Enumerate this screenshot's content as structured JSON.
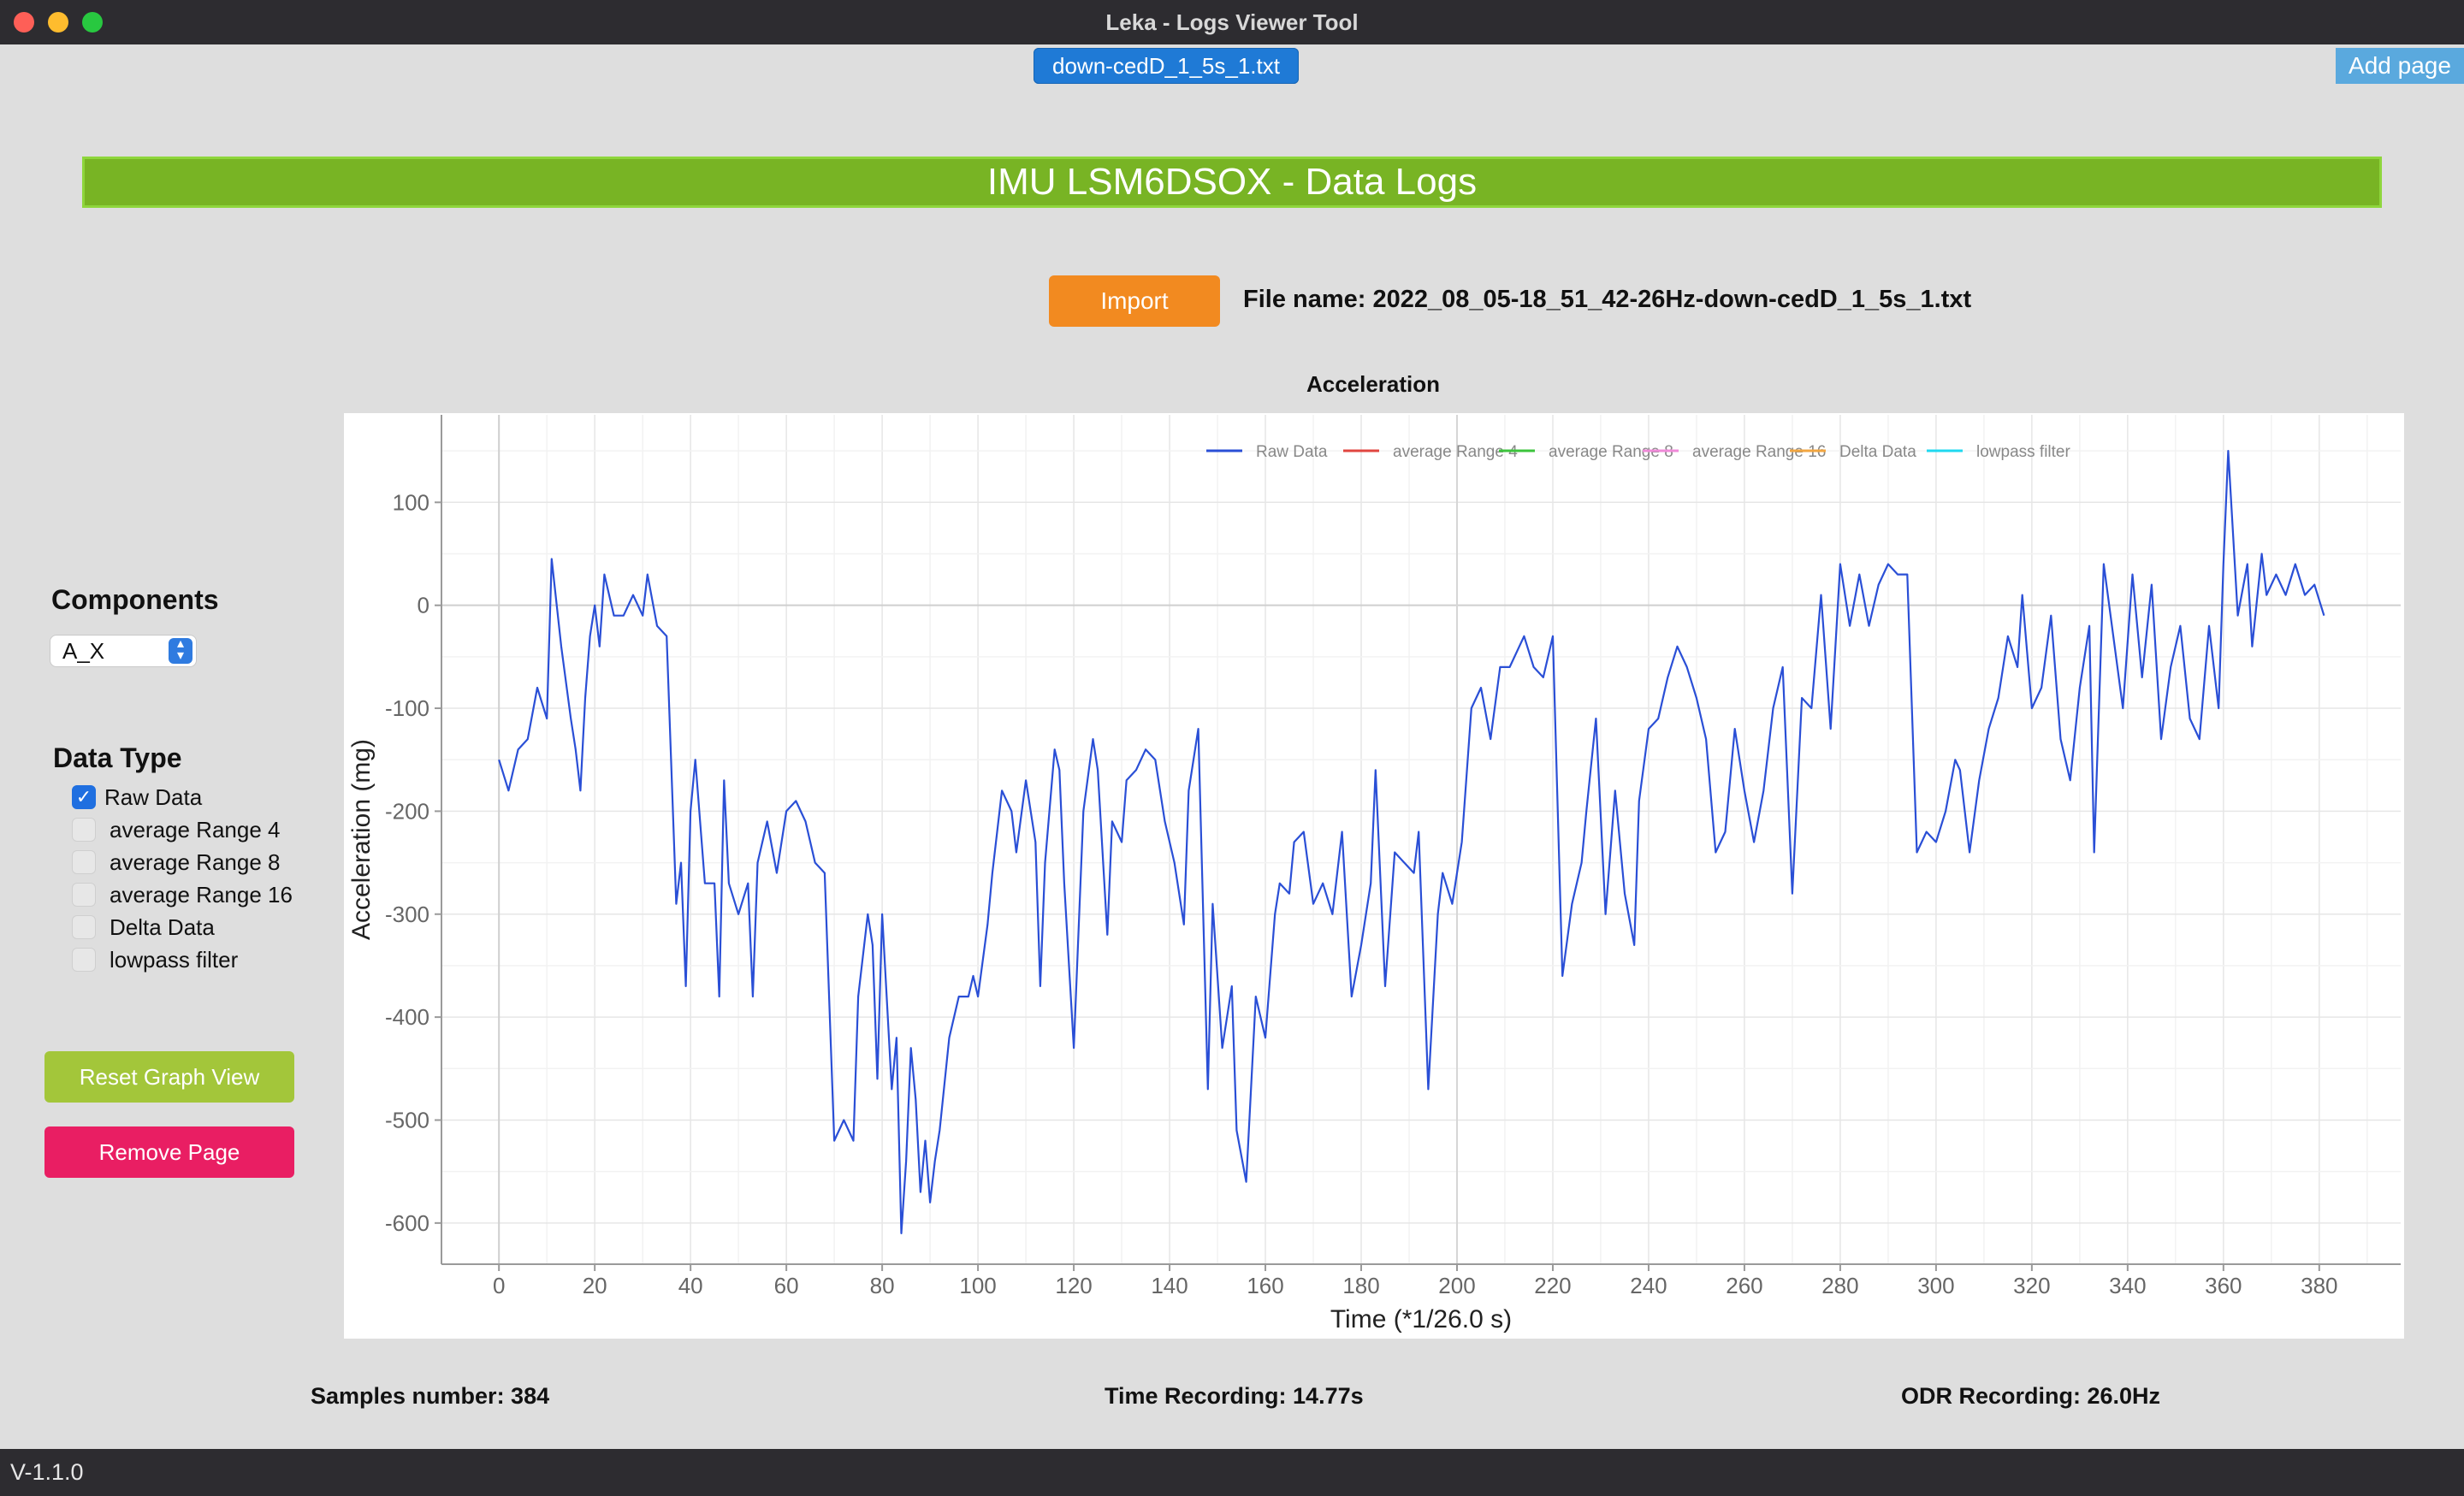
{
  "window": {
    "title": "Leka - Logs Viewer Tool"
  },
  "tabs": {
    "active_label": "down-cedD_1_5s_1.txt",
    "add_page_label": "Add page"
  },
  "header": {
    "title": "IMU LSM6DSOX - Data Logs"
  },
  "import": {
    "button_label": "Import",
    "file_name": "File name: 2022_08_05-18_51_42-26Hz-down-cedD_1_5s_1.txt"
  },
  "sidebar": {
    "components_title": "Components",
    "component_selected": "A_X",
    "data_type_title": "Data Type",
    "data_types": [
      {
        "label": "Raw Data",
        "checked": true
      },
      {
        "label": "average Range 4",
        "checked": false
      },
      {
        "label": "average Range 8",
        "checked": false
      },
      {
        "label": "average Range 16",
        "checked": false
      },
      {
        "label": "Delta Data",
        "checked": false
      },
      {
        "label": "lowpass filter",
        "checked": false
      }
    ],
    "reset_label": "Reset Graph View",
    "remove_label": "Remove Page"
  },
  "stats": {
    "samples": "Samples number: 384",
    "time": "Time Recording: 14.77s",
    "odr": "ODR Recording: 26.0Hz"
  },
  "status": {
    "version": "V-1.1.0"
  },
  "colors": {
    "raw": "#2a4fd6",
    "avg4": "#e0453f",
    "avg8": "#3cc43c",
    "avg16": "#f08ad8",
    "delta": "#f2a640",
    "lowpass": "#1fd8f0",
    "header_green": "#78b424",
    "import_orange": "#f28a20",
    "reset_green": "#a3c63a",
    "remove_pink": "#e91e63"
  },
  "chart_data": {
    "type": "line",
    "title": "Acceleration",
    "xlabel": "Time (*1/26.0 s)",
    "ylabel": "Acceleration (mg)",
    "xlim": [
      -12,
      397
    ],
    "ylim": [
      -640,
      185
    ],
    "x_ticks": [
      0,
      20,
      40,
      60,
      80,
      100,
      120,
      140,
      160,
      180,
      200,
      220,
      240,
      260,
      280,
      300,
      320,
      340,
      360,
      380
    ],
    "y_ticks": [
      100,
      0,
      -100,
      -200,
      -300,
      -400,
      -500,
      -600
    ],
    "legend_position": "top-right",
    "grid": true,
    "series": [
      {
        "name": "Raw Data",
        "color": "#2a4fd6",
        "points": [
          [
            0,
            -150
          ],
          [
            2,
            -180
          ],
          [
            4,
            -140
          ],
          [
            6,
            -130
          ],
          [
            8,
            -80
          ],
          [
            10,
            -110
          ],
          [
            11,
            45
          ],
          [
            13,
            -40
          ],
          [
            15,
            -110
          ],
          [
            16,
            -140
          ],
          [
            17,
            -180
          ],
          [
            18,
            -90
          ],
          [
            19,
            -30
          ],
          [
            20,
            0
          ],
          [
            21,
            -40
          ],
          [
            22,
            30
          ],
          [
            24,
            -10
          ],
          [
            26,
            -10
          ],
          [
            28,
            10
          ],
          [
            30,
            -10
          ],
          [
            31,
            30
          ],
          [
            33,
            -20
          ],
          [
            35,
            -30
          ],
          [
            37,
            -290
          ],
          [
            38,
            -250
          ],
          [
            39,
            -370
          ],
          [
            40,
            -200
          ],
          [
            41,
            -150
          ],
          [
            43,
            -270
          ],
          [
            45,
            -270
          ],
          [
            46,
            -380
          ],
          [
            47,
            -170
          ],
          [
            48,
            -270
          ],
          [
            50,
            -300
          ],
          [
            52,
            -270
          ],
          [
            53,
            -380
          ],
          [
            54,
            -250
          ],
          [
            56,
            -210
          ],
          [
            58,
            -260
          ],
          [
            60,
            -200
          ],
          [
            62,
            -190
          ],
          [
            64,
            -210
          ],
          [
            66,
            -250
          ],
          [
            68,
            -260
          ],
          [
            70,
            -520
          ],
          [
            72,
            -500
          ],
          [
            74,
            -520
          ],
          [
            75,
            -380
          ],
          [
            77,
            -300
          ],
          [
            78,
            -330
          ],
          [
            79,
            -460
          ],
          [
            80,
            -300
          ],
          [
            82,
            -470
          ],
          [
            83,
            -420
          ],
          [
            84,
            -610
          ],
          [
            85,
            -540
          ],
          [
            86,
            -430
          ],
          [
            87,
            -480
          ],
          [
            88,
            -570
          ],
          [
            89,
            -520
          ],
          [
            90,
            -580
          ],
          [
            91,
            -540
          ],
          [
            92,
            -510
          ],
          [
            94,
            -420
          ],
          [
            96,
            -380
          ],
          [
            98,
            -380
          ],
          [
            99,
            -360
          ],
          [
            100,
            -380
          ],
          [
            102,
            -310
          ],
          [
            103,
            -260
          ],
          [
            105,
            -180
          ],
          [
            107,
            -200
          ],
          [
            108,
            -240
          ],
          [
            110,
            -170
          ],
          [
            112,
            -230
          ],
          [
            113,
            -370
          ],
          [
            114,
            -250
          ],
          [
            116,
            -140
          ],
          [
            117,
            -160
          ],
          [
            118,
            -270
          ],
          [
            120,
            -430
          ],
          [
            122,
            -200
          ],
          [
            124,
            -130
          ],
          [
            125,
            -160
          ],
          [
            127,
            -320
          ],
          [
            128,
            -210
          ],
          [
            130,
            -230
          ],
          [
            131,
            -170
          ],
          [
            133,
            -160
          ],
          [
            135,
            -140
          ],
          [
            137,
            -150
          ],
          [
            139,
            -210
          ],
          [
            141,
            -250
          ],
          [
            143,
            -310
          ],
          [
            144,
            -180
          ],
          [
            146,
            -120
          ],
          [
            148,
            -470
          ],
          [
            149,
            -290
          ],
          [
            151,
            -430
          ],
          [
            153,
            -370
          ],
          [
            154,
            -510
          ],
          [
            156,
            -560
          ],
          [
            158,
            -380
          ],
          [
            160,
            -420
          ],
          [
            162,
            -300
          ],
          [
            163,
            -270
          ],
          [
            165,
            -280
          ],
          [
            166,
            -230
          ],
          [
            168,
            -220
          ],
          [
            170,
            -290
          ],
          [
            172,
            -270
          ],
          [
            174,
            -300
          ],
          [
            176,
            -220
          ],
          [
            178,
            -380
          ],
          [
            180,
            -330
          ],
          [
            182,
            -270
          ],
          [
            183,
            -160
          ],
          [
            185,
            -370
          ],
          [
            187,
            -240
          ],
          [
            189,
            -250
          ],
          [
            191,
            -260
          ],
          [
            192,
            -220
          ],
          [
            194,
            -470
          ],
          [
            196,
            -300
          ],
          [
            197,
            -260
          ],
          [
            199,
            -290
          ],
          [
            201,
            -230
          ],
          [
            203,
            -100
          ],
          [
            205,
            -80
          ],
          [
            207,
            -130
          ],
          [
            209,
            -60
          ],
          [
            211,
            -60
          ],
          [
            213,
            -40
          ],
          [
            214,
            -30
          ],
          [
            216,
            -60
          ],
          [
            218,
            -70
          ],
          [
            220,
            -30
          ],
          [
            222,
            -360
          ],
          [
            224,
            -290
          ],
          [
            226,
            -250
          ],
          [
            227,
            -200
          ],
          [
            229,
            -110
          ],
          [
            231,
            -300
          ],
          [
            233,
            -180
          ],
          [
            235,
            -280
          ],
          [
            237,
            -330
          ],
          [
            238,
            -190
          ],
          [
            240,
            -120
          ],
          [
            242,
            -110
          ],
          [
            244,
            -70
          ],
          [
            246,
            -40
          ],
          [
            248,
            -60
          ],
          [
            250,
            -90
          ],
          [
            252,
            -130
          ],
          [
            254,
            -240
          ],
          [
            256,
            -220
          ],
          [
            258,
            -120
          ],
          [
            260,
            -180
          ],
          [
            262,
            -230
          ],
          [
            264,
            -180
          ],
          [
            266,
            -100
          ],
          [
            268,
            -60
          ],
          [
            270,
            -280
          ],
          [
            272,
            -90
          ],
          [
            274,
            -100
          ],
          [
            276,
            10
          ],
          [
            278,
            -120
          ],
          [
            280,
            40
          ],
          [
            282,
            -20
          ],
          [
            284,
            30
          ],
          [
            286,
            -20
          ],
          [
            288,
            20
          ],
          [
            290,
            40
          ],
          [
            292,
            30
          ],
          [
            294,
            30
          ],
          [
            296,
            -240
          ],
          [
            298,
            -220
          ],
          [
            300,
            -230
          ],
          [
            302,
            -200
          ],
          [
            304,
            -150
          ],
          [
            305,
            -160
          ],
          [
            307,
            -240
          ],
          [
            309,
            -170
          ],
          [
            311,
            -120
          ],
          [
            313,
            -90
          ],
          [
            315,
            -30
          ],
          [
            317,
            -60
          ],
          [
            318,
            10
          ],
          [
            320,
            -100
          ],
          [
            322,
            -80
          ],
          [
            324,
            -10
          ],
          [
            326,
            -130
          ],
          [
            328,
            -170
          ],
          [
            330,
            -80
          ],
          [
            332,
            -20
          ],
          [
            333,
            -240
          ],
          [
            335,
            40
          ],
          [
            337,
            -30
          ],
          [
            339,
            -100
          ],
          [
            341,
            30
          ],
          [
            343,
            -70
          ],
          [
            345,
            20
          ],
          [
            347,
            -130
          ],
          [
            349,
            -60
          ],
          [
            351,
            -20
          ],
          [
            353,
            -110
          ],
          [
            355,
            -130
          ],
          [
            357,
            -20
          ],
          [
            359,
            -100
          ],
          [
            360,
            40
          ],
          [
            361,
            150
          ],
          [
            363,
            -10
          ],
          [
            365,
            40
          ],
          [
            366,
            -40
          ],
          [
            368,
            50
          ],
          [
            369,
            10
          ],
          [
            371,
            30
          ],
          [
            373,
            10
          ],
          [
            375,
            40
          ],
          [
            377,
            10
          ],
          [
            379,
            20
          ],
          [
            381,
            -10
          ]
        ]
      },
      {
        "name": "average Range 4",
        "color": "#e0453f",
        "points": []
      },
      {
        "name": "average Range 8",
        "color": "#3cc43c",
        "points": []
      },
      {
        "name": "average Range 16",
        "color": "#f08ad8",
        "points": []
      },
      {
        "name": "Delta Data",
        "color": "#f2a640",
        "points": []
      },
      {
        "name": "lowpass filter",
        "color": "#1fd8f0",
        "points": []
      }
    ]
  }
}
